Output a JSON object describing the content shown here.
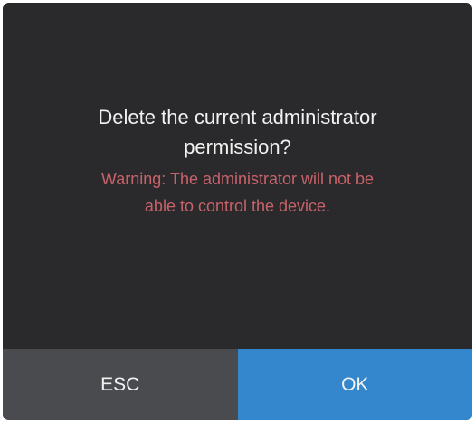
{
  "dialog": {
    "title": "Delete the current administrator permission?",
    "warning": "Warning: The administrator will not be able to control the device.",
    "buttons": {
      "esc_label": "ESC",
      "ok_label": "OK"
    }
  },
  "colors": {
    "background": "#2a2a2c",
    "title_text": "#f2f2f2",
    "warning_text": "#c8626a",
    "esc_button": "#494b4e",
    "ok_button": "#3487cc"
  }
}
